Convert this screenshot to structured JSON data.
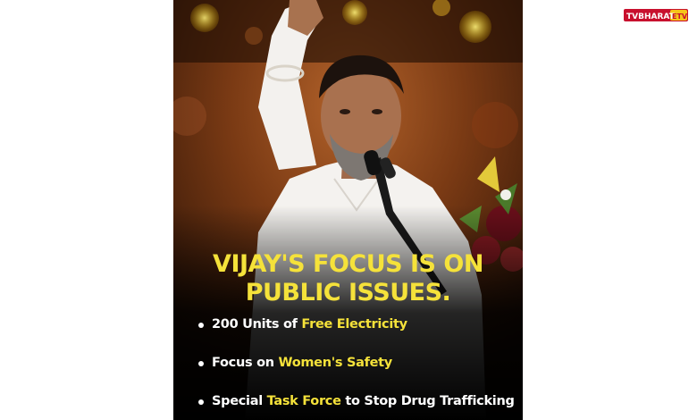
{
  "logo": {
    "brand_prefix": "TVBHARAT",
    "brand_suffix": "ETV"
  },
  "poster": {
    "headline_line1": "VIJAY'S FOCUS IS ON",
    "headline_line2": "PUBLIC ISSUES.",
    "points": [
      {
        "before": "200 Units of ",
        "highlight": "Free Electricity",
        "after": ""
      },
      {
        "before": "Focus on ",
        "highlight": "Women's Safety",
        "after": ""
      },
      {
        "before": "Special ",
        "highlight": "Task Force",
        "after": " to Stop Drug Trafficking"
      }
    ]
  },
  "colors": {
    "accent_yellow": "#f5e23a",
    "background_dark": "#140a05",
    "logo_red": "#c8102e"
  }
}
